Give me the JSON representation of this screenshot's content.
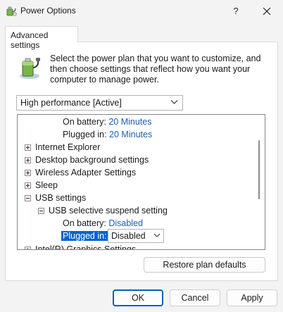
{
  "window": {
    "title": "Power Options",
    "help_label": "?",
    "icon": "power-options-icon"
  },
  "tab": {
    "label": "Advanced settings"
  },
  "description": "Select the power plan that you want to customize, and then choose settings that reflect how you want your computer to manage power.",
  "plan_select": {
    "value": "High performance [Active]"
  },
  "tree": {
    "rows": [
      {
        "label": "On battery:",
        "value": "20 Minutes"
      },
      {
        "label": "Plugged in:",
        "value": "20 Minutes"
      },
      {
        "label": "Internet Explorer",
        "expander": "plus"
      },
      {
        "label": "Desktop background settings",
        "expander": "plus"
      },
      {
        "label": "Wireless Adapter Settings",
        "expander": "plus"
      },
      {
        "label": "Sleep",
        "expander": "plus"
      },
      {
        "label": "USB settings",
        "expander": "minus"
      },
      {
        "label": "USB selective suspend setting",
        "expander": "minus"
      },
      {
        "label": "On battery:",
        "value": "Disabled"
      },
      {
        "label": "Plugged in:",
        "value": "Disabled",
        "selected": true
      },
      {
        "label": "Intel(R) Graphics Settings",
        "expander": "plus"
      }
    ]
  },
  "buttons": {
    "restore": "Restore plan defaults",
    "ok": "OK",
    "cancel": "Cancel",
    "apply": "Apply"
  },
  "colors": {
    "accent": "#0a64c8",
    "link": "#1a5fb4"
  }
}
